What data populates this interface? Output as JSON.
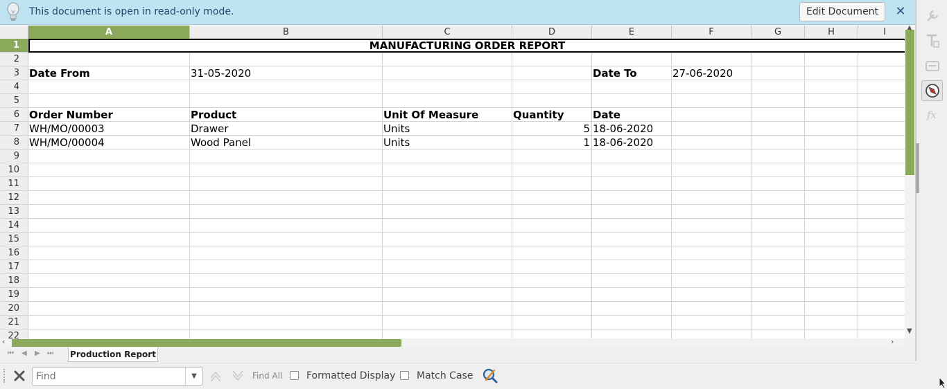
{
  "infobar": {
    "message": "This document is open in read-only mode.",
    "edit_button": "Edit Document",
    "close_label": "✕"
  },
  "columns": [
    "A",
    "B",
    "C",
    "D",
    "E",
    "F",
    "G",
    "H",
    "I"
  ],
  "rows": [
    "1",
    "2",
    "3",
    "4",
    "5",
    "6",
    "7",
    "8",
    "9",
    "10",
    "11",
    "12",
    "13",
    "14",
    "15",
    "16",
    "17",
    "18",
    "19",
    "20",
    "21",
    "22"
  ],
  "selected_cell": "A1",
  "sheet": {
    "title": "MANUFACTURING ORDER REPORT",
    "date_from_label": "Date From",
    "date_from": "31-05-2020",
    "date_to_label": "Date To",
    "date_to": "27-06-2020",
    "headers": {
      "order_number": "Order Number",
      "product": "Product",
      "uom": "Unit Of Measure",
      "quantity": "Quantity",
      "date": "Date"
    },
    "orders": [
      {
        "order_number": "WH/MO/00003",
        "product": "Drawer",
        "uom": "Units",
        "quantity": "5",
        "date": "18-06-2020"
      },
      {
        "order_number": "WH/MO/00004",
        "product": "Wood Panel",
        "uom": "Units",
        "quantity": "1",
        "date": "18-06-2020"
      }
    ]
  },
  "tabs": {
    "active": "Production Report"
  },
  "findbar": {
    "placeholder": "Find",
    "find_all": "Find All",
    "formatted_display": "Formatted Display",
    "match_case": "Match Case"
  },
  "colors": {
    "accent": "#8ba95b",
    "infobar_bg": "#bfe3f0"
  }
}
